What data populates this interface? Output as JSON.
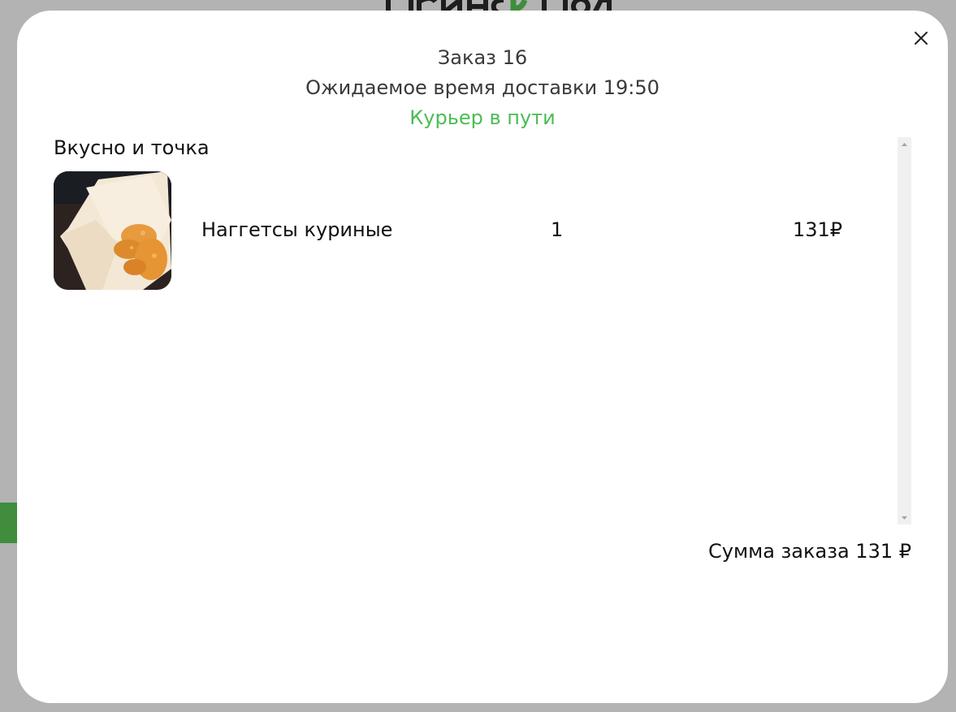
{
  "backdrop": {
    "logo_icon": "brand-logo",
    "accent_color": "#3f8d3d"
  },
  "modal": {
    "close_icon": "close-icon",
    "order_title": "Заказ 16",
    "delivery_time": "Ожидаемое время доставки 19:50",
    "status": "Курьер в пути",
    "status_color": "#4cbc55",
    "restaurant_name": "Вкусно и точка",
    "items": [
      {
        "image_icon": "nuggets-photo",
        "name": "Наггетсы куриные",
        "quantity": "1",
        "price": "131₽"
      }
    ],
    "total": "Сумма заказа 131 ₽"
  }
}
